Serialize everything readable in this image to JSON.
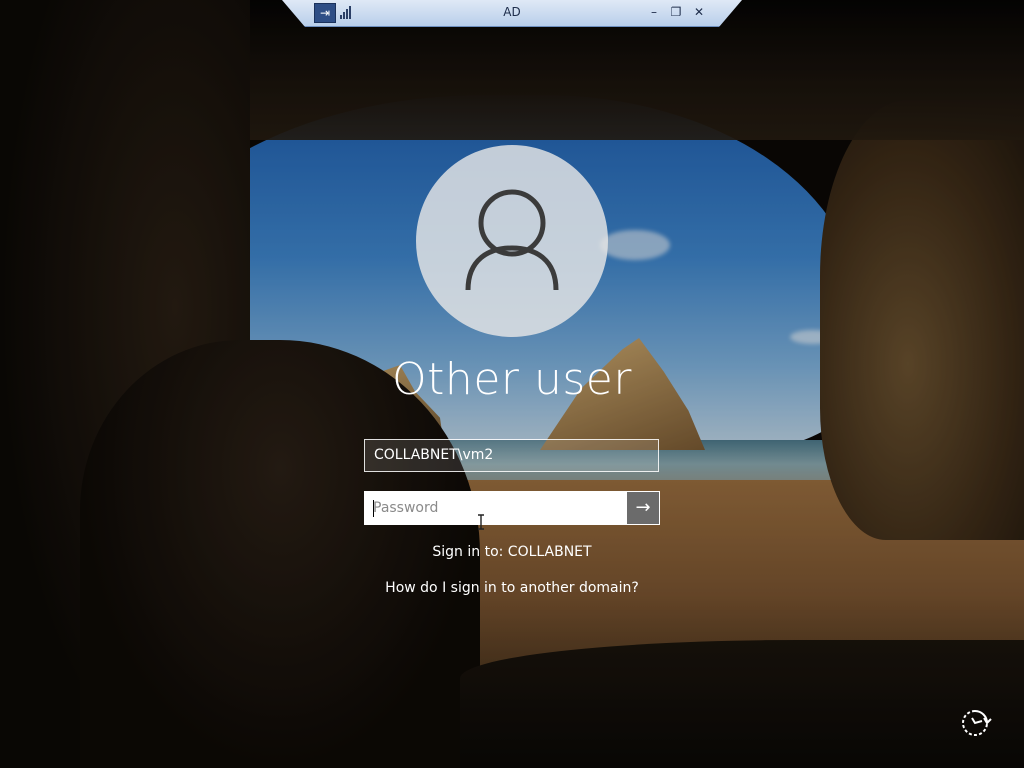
{
  "rdp_bar": {
    "title": "AD",
    "pin_glyph": "⇥",
    "minimize_glyph": "–",
    "restore_glyph": "❐",
    "close_glyph": "✕"
  },
  "login": {
    "user_display_name": "Other user",
    "username_value": "COLLABNET\\vm2",
    "password_placeholder": "Password",
    "submit_glyph": "→",
    "sign_in_to": "Sign in to: COLLABNET",
    "other_domain_link": "How do I sign in to another domain?"
  },
  "icons": {
    "avatar": "user-avatar-icon",
    "power": "power-options-icon",
    "signal": "connection-signal-icon"
  },
  "colors": {
    "rdp_bar": "#c7d8ee",
    "submit_button": "#6b6b6b",
    "text": "#ffffff"
  }
}
